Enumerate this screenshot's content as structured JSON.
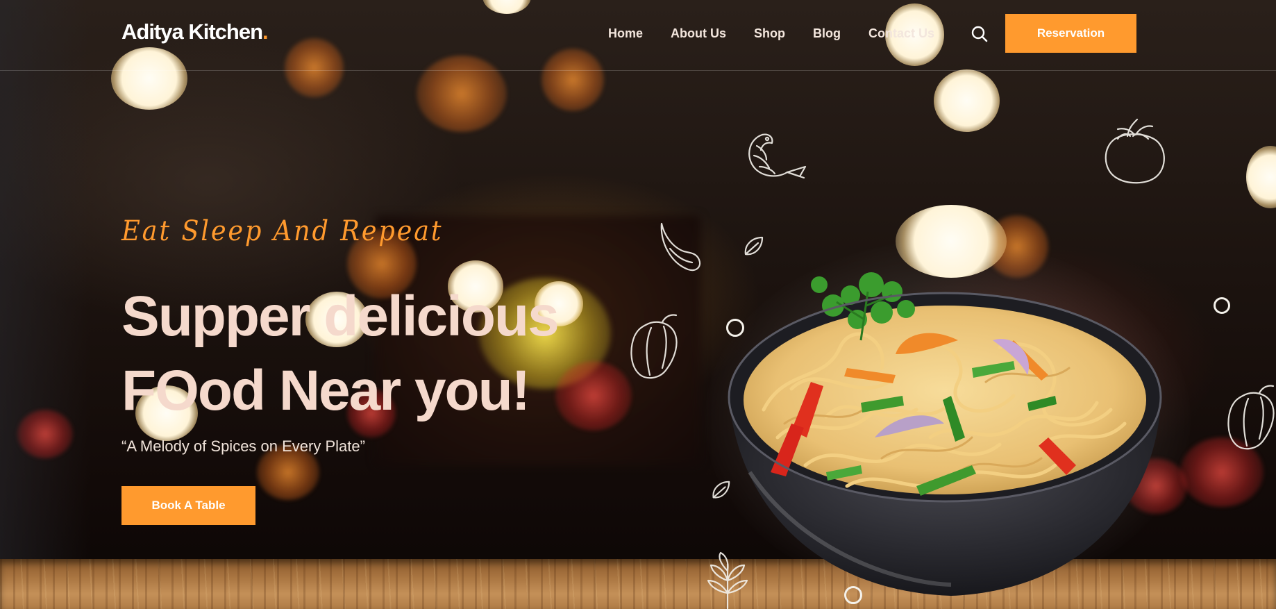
{
  "brand": {
    "name": "Aditya Kitchen",
    "dot": ".",
    "accent_color": "#ff9a2e"
  },
  "nav": {
    "items": [
      {
        "label": "Home"
      },
      {
        "label": "About Us"
      },
      {
        "label": "Shop"
      },
      {
        "label": "Blog"
      },
      {
        "label": "Contact Us"
      }
    ],
    "search_icon": "search-icon",
    "reservation_label": "Reservation"
  },
  "hero": {
    "tagline": "Eat Sleep And Repeat",
    "title_line1": "Supper delicious",
    "title_line2": "FOod Near you!",
    "motto": "“A Melody of Spices on Every Plate”",
    "cta_label": "Book A Table",
    "title_color": "#f5d9cc"
  },
  "decor": {
    "dish": "noodle-bowl-image",
    "doodles": [
      "shrimp-doodle-icon",
      "tomato-doodle-icon",
      "garlic-doodle-icon",
      "leaf-doodle-icon",
      "pepper-doodle-icon",
      "herb-doodle-icon"
    ]
  }
}
